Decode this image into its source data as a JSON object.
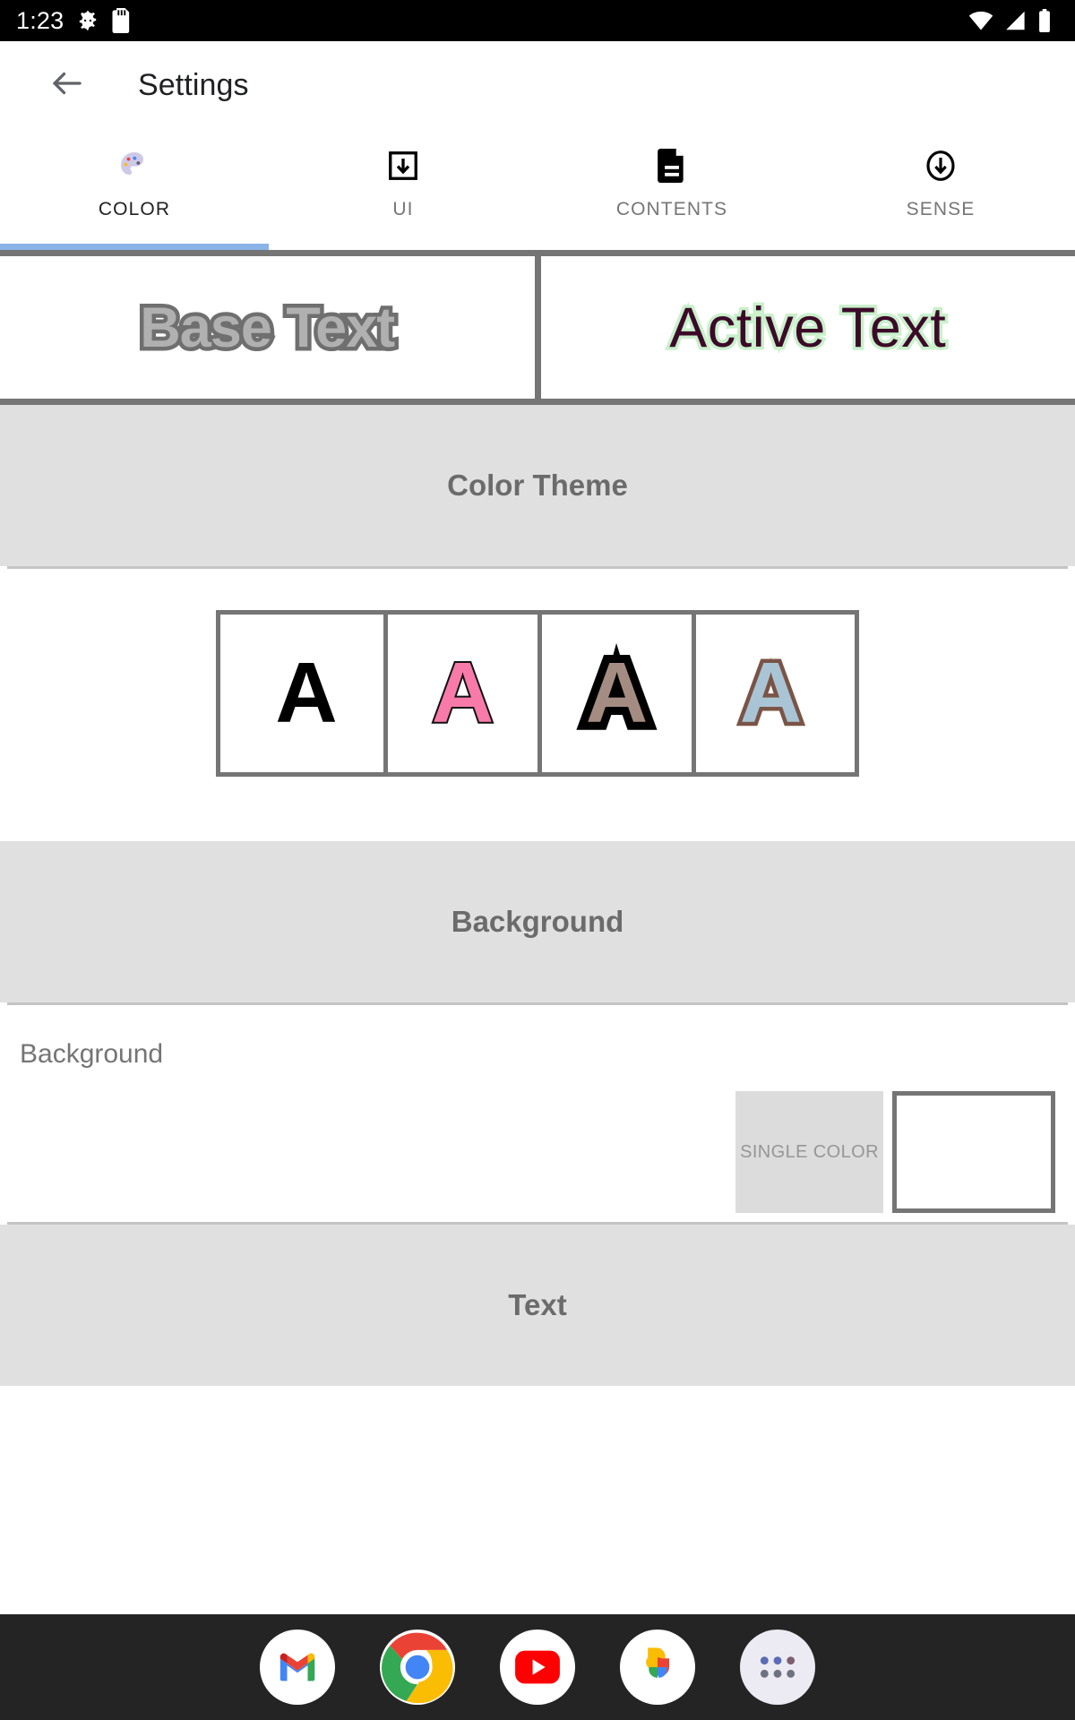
{
  "statusbar": {
    "time": "1:23",
    "left_icons": [
      "android-gear-icon",
      "sd-card-icon"
    ],
    "right_icons": [
      "wifi-icon",
      "cell-signal-icon",
      "battery-icon"
    ],
    "background_color": "#000000"
  },
  "appbar": {
    "back_icon": "back-arrow-icon",
    "title": "Settings"
  },
  "tabs": {
    "active_index": 0,
    "indicator_color": "#8ab4e8",
    "items": [
      {
        "label": "COLOR",
        "icon": "palette-icon"
      },
      {
        "label": "UI",
        "icon": "box-download-icon"
      },
      {
        "label": "CONTENTS",
        "icon": "document-icon"
      },
      {
        "label": "SENSE",
        "icon": "circle-download-icon"
      }
    ]
  },
  "preview": {
    "base": {
      "text": "Base Text",
      "fill": "#b0b0b0",
      "outline": "#6f6f6f"
    },
    "active": {
      "text": "Active Text",
      "fill": "#3c0a29",
      "outline": "#c9f0cb"
    }
  },
  "sections": {
    "color_theme": {
      "title": "Color Theme",
      "swatches": [
        {
          "glyph": "A",
          "fill": "#000000",
          "outline": "none"
        },
        {
          "glyph": "A",
          "fill": "#f87aa8",
          "outline": "#111111"
        },
        {
          "glyph": "A",
          "fill": "#a58c82",
          "outline": "#000000"
        },
        {
          "glyph": "A",
          "fill": "#a9c5d5",
          "outline": "#7a5446"
        }
      ]
    },
    "background": {
      "title": "Background",
      "row_label": "Background",
      "single_color_label": "SINGLE COLOR",
      "swatch_color": "#ffffff"
    },
    "text": {
      "title": "Text"
    }
  },
  "dock": {
    "background_color": "#242424",
    "items": [
      {
        "name": "gmail"
      },
      {
        "name": "chrome"
      },
      {
        "name": "youtube"
      },
      {
        "name": "google-photos"
      },
      {
        "name": "app-drawer"
      }
    ]
  }
}
